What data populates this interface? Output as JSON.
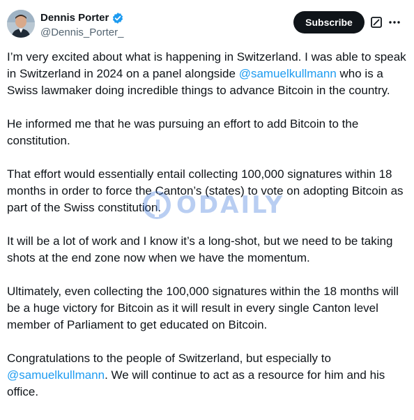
{
  "author": {
    "display_name": "Dennis Porter",
    "handle": "@Dennis_Porter_",
    "verified": true
  },
  "actions": {
    "subscribe_label": "Subscribe",
    "grok_icon": "grok-icon",
    "more_icon": "more-icon"
  },
  "post": {
    "paragraphs": [
      {
        "before": "I’m very excited about what is happening in Switzerland. I was able to speak in Switzerland in 2024 on a panel alongside ",
        "mention": "@samuelkullmann",
        "after": " who is a Swiss lawmaker doing incredible things to advance Bitcoin in the country."
      },
      {
        "text": "He informed me that he was pursuing an effort to add Bitcoin to the constitution."
      },
      {
        "text": "That effort would essentially entail collecting 100,000 signatures within 18 months in order to force the Canton’s (states) to vote on adopting Bitcoin as part of the Swiss constitution."
      },
      {
        "text": "It will be a lot of work and I know it’s a long-shot, but we need to be taking shots at the end zone now when we have the momentum."
      },
      {
        "text": "Ultimately, even collecting the 100,000 signatures within the 18 months will be a huge victory for Bitcoin as it will result in every single Canton level member of Parliament to get educated on Bitcoin."
      },
      {
        "before": "Congratulations to the people of Switzerland, but especially to ",
        "mention": "@samuelkullmann",
        "after": ". We will continue to act as a resource for him and his office."
      }
    ]
  },
  "watermark": {
    "text": "ODAILY"
  },
  "colors": {
    "text": "#0f1419",
    "secondary": "#536471",
    "link": "#1d9bf0",
    "verified": "#1d9bf0",
    "button": "#0f1419"
  }
}
